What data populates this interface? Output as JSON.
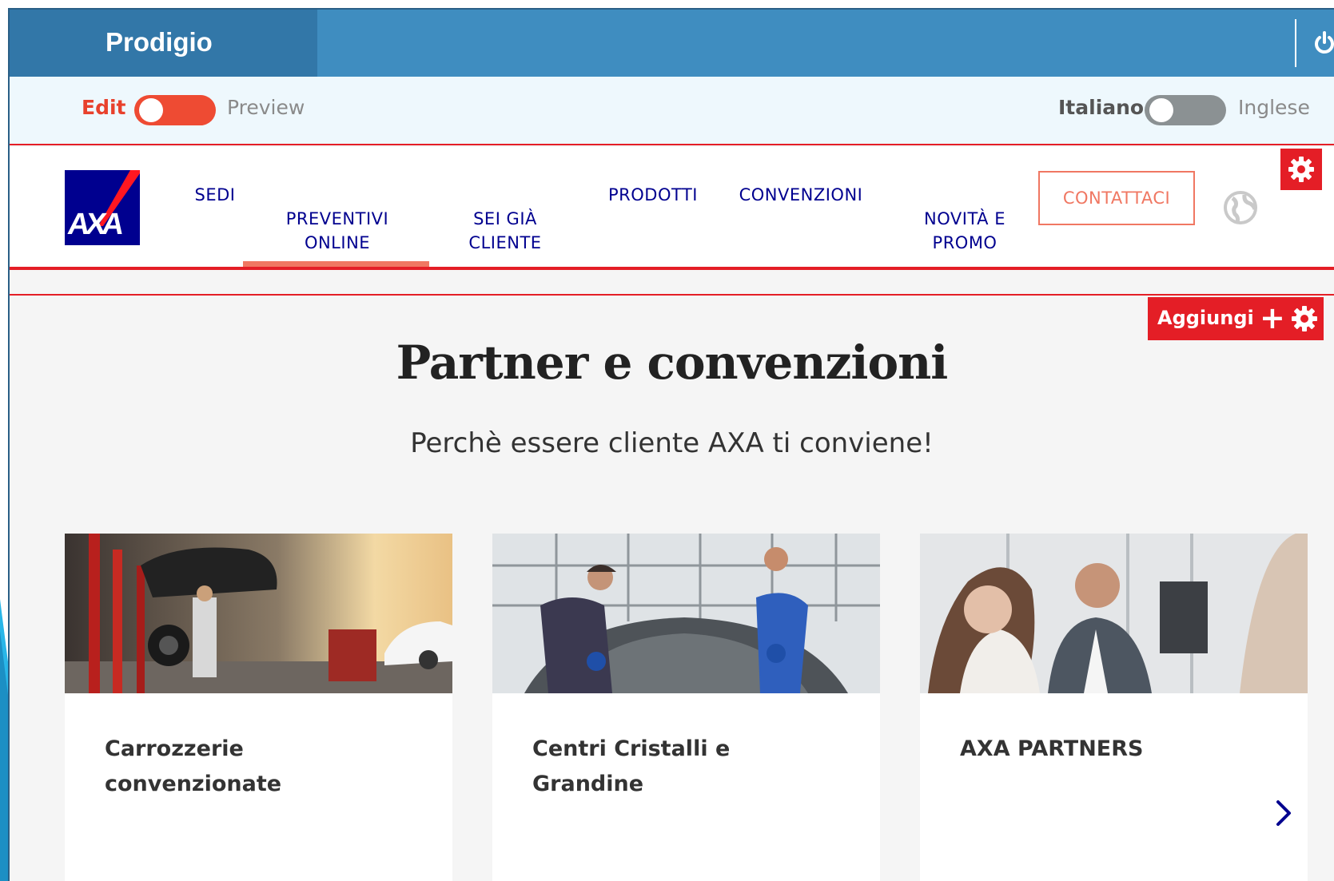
{
  "app": {
    "title": "Prodigio"
  },
  "modebar": {
    "edit_label": "Edit",
    "preview_label": "Preview",
    "lang_left": "Italiano",
    "lang_right": "Inglese"
  },
  "navbar": {
    "logo_text": "AXA",
    "items": [
      {
        "label": "SEDI"
      },
      {
        "label": "PREVENTIVI\nONLINE"
      },
      {
        "label": "SEI GIÀ\nCLIENTE"
      },
      {
        "label": "PRODOTTI"
      },
      {
        "label": "CONVENZIONI"
      },
      {
        "label": "NOVITÀ E\nPROMO"
      }
    ],
    "contact_label": "CONTATTACI"
  },
  "main": {
    "add_label": "Aggiungi",
    "add_symbol": "+",
    "title": "Partner e convenzioni",
    "subtitle": "Perchè essere cliente AXA ti conviene!",
    "cards": [
      {
        "title": "Carrozzerie convenzionate"
      },
      {
        "title": "Centri Cristalli e Grandine"
      },
      {
        "title": "AXA PARTNERS"
      }
    ]
  },
  "colors": {
    "topbar": "#3f8dc0",
    "brand_bg": "#3277a8",
    "accent_red": "#e41e26",
    "axa_blue": "#00008f",
    "coral": "#f07762"
  },
  "icons": [
    "power-icon",
    "gear-icon",
    "globe-icon",
    "plus-icon",
    "chevron-right-icon"
  ]
}
